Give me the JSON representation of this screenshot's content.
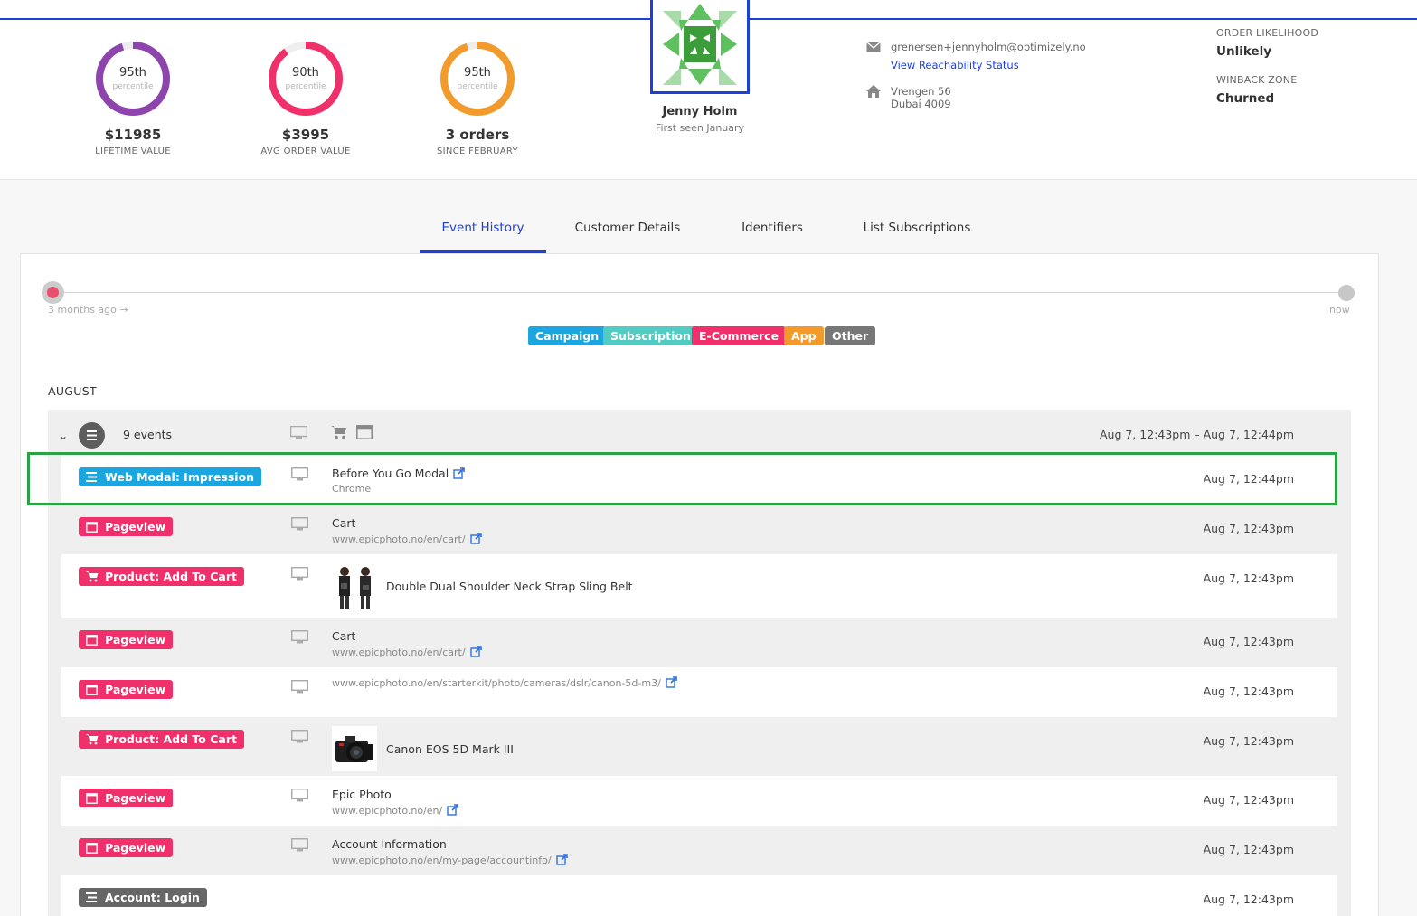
{
  "stats": [
    {
      "pct": "95th",
      "pct_sub": "percentile",
      "value": "$11985",
      "label": "LIFETIME VALUE",
      "color": "#8e44ad",
      "fraction": 0.95
    },
    {
      "pct": "90th",
      "pct_sub": "percentile",
      "value": "$3995",
      "label": "AVG ORDER VALUE",
      "color": "#f0306a",
      "fraction": 0.9
    },
    {
      "pct": "95th",
      "pct_sub": "percentile",
      "value": "3 orders",
      "label": "SINCE FEBRUARY",
      "color": "#f39a2c",
      "fraction": 0.95
    }
  ],
  "profile": {
    "name": "Jenny Holm",
    "first_seen": "First seen January",
    "email": "grenersen+jennyholm@optimizely.no",
    "reachability_link": "View Reachability Status",
    "address_line1": "Vrengen 56",
    "address_line2": "Dubai 4009"
  },
  "likelihood": {
    "order_label": "ORDER LIKELIHOOD",
    "order_value": "Unlikely",
    "winback_label": "WINBACK ZONE",
    "winback_value": "Churned"
  },
  "tabs": [
    {
      "label": "Event History",
      "active": true
    },
    {
      "label": "Customer Details",
      "active": false
    },
    {
      "label": "Identifiers",
      "active": false
    },
    {
      "label": "List Subscriptions",
      "active": false
    }
  ],
  "timeline": {
    "start_label": "3 months ago →",
    "end_label": "now"
  },
  "legend": [
    {
      "label": "Campaign",
      "color": "#1ba6e0"
    },
    {
      "label": "Subscription",
      "color": "#52cbc3"
    },
    {
      "label": "E-Commerce",
      "color": "#f0306a"
    },
    {
      "label": "App",
      "color": "#f39a2c"
    },
    {
      "label": "Other",
      "color": "#777777"
    }
  ],
  "month": "AUGUST",
  "group": {
    "count": "9 events",
    "time_range": "Aug 7, 12:43pm – Aug 7, 12:44pm"
  },
  "events": [
    {
      "type": "Web Modal: Impression",
      "color": "#1ba6e0",
      "icon": "list-icon",
      "title": "Before You Go Modal",
      "sub": "Chrome",
      "time": "Aug 7, 12:44pm"
    },
    {
      "type": "Pageview",
      "color": "#f0306a",
      "icon": "browser-icon",
      "title": "Cart",
      "sub": "www.epicphoto.no/en/cart/",
      "time": "Aug 7, 12:43pm"
    },
    {
      "type": "Product: Add To Cart",
      "color": "#f0306a",
      "icon": "cart-icon",
      "title": "Double Dual Shoulder Neck Strap Sling Belt",
      "sub": "",
      "time": "Aug 7, 12:43pm"
    },
    {
      "type": "Pageview",
      "color": "#f0306a",
      "icon": "browser-icon",
      "title": "Cart",
      "sub": "www.epicphoto.no/en/cart/",
      "time": "Aug 7, 12:43pm"
    },
    {
      "type": "Pageview",
      "color": "#f0306a",
      "icon": "browser-icon",
      "title": "",
      "sub": "www.epicphoto.no/en/starterkit/photo/cameras/dslr/canon-5d-m3/",
      "time": "Aug 7, 12:43pm"
    },
    {
      "type": "Product: Add To Cart",
      "color": "#f0306a",
      "icon": "cart-icon",
      "title": "Canon EOS 5D Mark III",
      "sub": "",
      "time": "Aug 7, 12:43pm"
    },
    {
      "type": "Pageview",
      "color": "#f0306a",
      "icon": "browser-icon",
      "title": "Epic Photo",
      "sub": "www.epicphoto.no/en/",
      "time": "Aug 7, 12:43pm"
    },
    {
      "type": "Pageview",
      "color": "#f0306a",
      "icon": "browser-icon",
      "title": "Account Information",
      "sub": "www.epicphoto.no/en/my-page/accountinfo/",
      "time": "Aug 7, 12:43pm"
    },
    {
      "type": "Account: Login",
      "color": "#666666",
      "icon": "list-icon",
      "title": "",
      "sub": "",
      "time": "Aug 7, 12:43pm"
    }
  ]
}
